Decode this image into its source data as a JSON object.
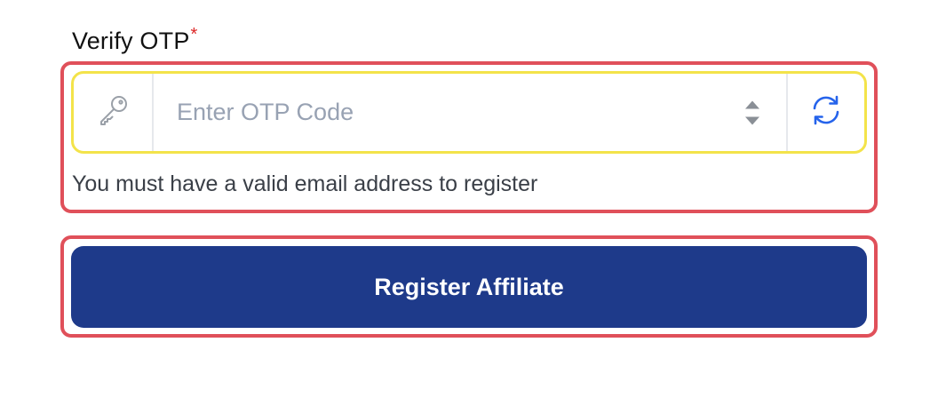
{
  "form": {
    "otp_label": "Verify OTP",
    "required_marker": "*",
    "otp_placeholder": "Enter OTP Code",
    "otp_value": "",
    "help_text": "You must have a valid email address to register",
    "submit_label": "Register Affiliate"
  },
  "icons": {
    "left_addon": "key-icon",
    "right_addon": "refresh-icon",
    "spinner_up": "caret-up-icon",
    "spinner_down": "caret-down-icon"
  },
  "colors": {
    "primary_button": "#1e3a8a",
    "highlight_outline": "#e0505a",
    "input_focus_border": "#f3e34a",
    "required_marker": "#dc2626",
    "refresh_icon": "#2563eb"
  }
}
